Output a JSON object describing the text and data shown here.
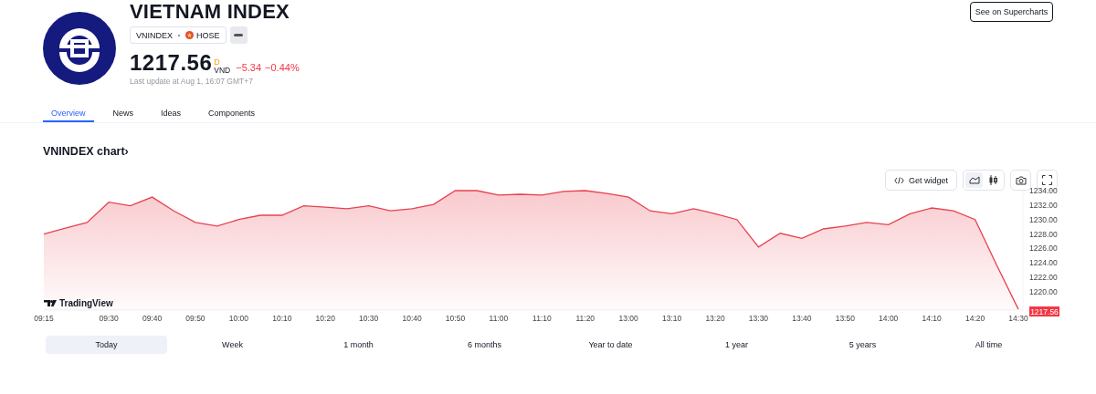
{
  "header": {
    "title": "VIETNAM INDEX",
    "symbol": "VNINDEX",
    "exchange": "HOSE",
    "price": "1217.56",
    "currency_symbol": "D",
    "currency": "VND",
    "change": "−5.34",
    "change_percent": "−0.44%",
    "last_update": "Last update at Aug 1, 16:07 GMT+7",
    "button": "See on Supercharts"
  },
  "tabs": [
    {
      "label": "Overview",
      "selected": true
    },
    {
      "label": "News",
      "selected": false
    },
    {
      "label": "Ideas",
      "selected": false
    },
    {
      "label": "Components",
      "selected": false
    }
  ],
  "chart_section": {
    "title": "VNINDEX chart›",
    "widget_button": "Get widget",
    "chart_styles": [
      {
        "kind": "area",
        "selected": true
      },
      {
        "kind": "candles",
        "selected": false
      }
    ],
    "attribution": "TradingView",
    "last_price_label": "1217.56",
    "chart_data": {
      "type": "area",
      "categories": [
        "09:15",
        null,
        null,
        "09:30",
        null,
        "09:40",
        null,
        "09:50",
        null,
        "10:00",
        null,
        "10:10",
        null,
        "10:20",
        null,
        "10:30",
        null,
        "10:40",
        null,
        "10:50",
        null,
        "11:00",
        null,
        "11:10",
        null,
        "11:20",
        null,
        "13:00",
        null,
        "13:10",
        null,
        "13:20",
        null,
        "13:30",
        null,
        "13:40",
        null,
        "13:50",
        null,
        "14:00",
        null,
        "14:10",
        null,
        "14:20",
        null,
        "14:30"
      ],
      "series": [
        {
          "color": "#e8414f",
          "values": [
            1228.0,
            1228.8,
            1229.6,
            1232.4,
            1231.9,
            1233.1,
            1231.2,
            1229.6,
            1229.1,
            1230.0,
            1230.6,
            1230.6,
            1231.9,
            1231.7,
            1231.5,
            1231.9,
            1231.2,
            1231.5,
            1232.1,
            1234.0,
            1234.0,
            1233.4,
            1233.5,
            1233.4,
            1233.9,
            1234.0,
            1233.6,
            1233.1,
            1231.2,
            1230.8,
            1231.5,
            1230.8,
            1230.0,
            1226.2,
            1228.1,
            1227.4,
            1228.7,
            1229.1,
            1229.6,
            1229.3,
            1230.8,
            1231.6,
            1231.2,
            1230.0,
            1223.7,
            1217.6
          ]
        }
      ],
      "ylim": [
        1217.5,
        1234
      ],
      "yticks": [
        {
          "value": 1220,
          "label": "1220.00"
        },
        {
          "value": 1222,
          "label": "1222.00"
        },
        {
          "value": 1224,
          "label": "1224.00"
        },
        {
          "value": 1226,
          "label": "1226.00"
        },
        {
          "value": 1228,
          "label": "1228.00"
        },
        {
          "value": 1230,
          "label": "1230.00"
        },
        {
          "value": 1232,
          "label": "1232.00"
        },
        {
          "value": 1234,
          "label": "1234.00"
        }
      ]
    }
  },
  "ranges": [
    {
      "label": "Today",
      "selected": true
    },
    {
      "label": "Week",
      "selected": false
    },
    {
      "label": "1 month",
      "selected": false
    },
    {
      "label": "6 months",
      "selected": false
    },
    {
      "label": "Year to date",
      "selected": false
    },
    {
      "label": "1 year",
      "selected": false
    },
    {
      "label": "5 years",
      "selected": false
    },
    {
      "label": "All time",
      "selected": false
    }
  ]
}
